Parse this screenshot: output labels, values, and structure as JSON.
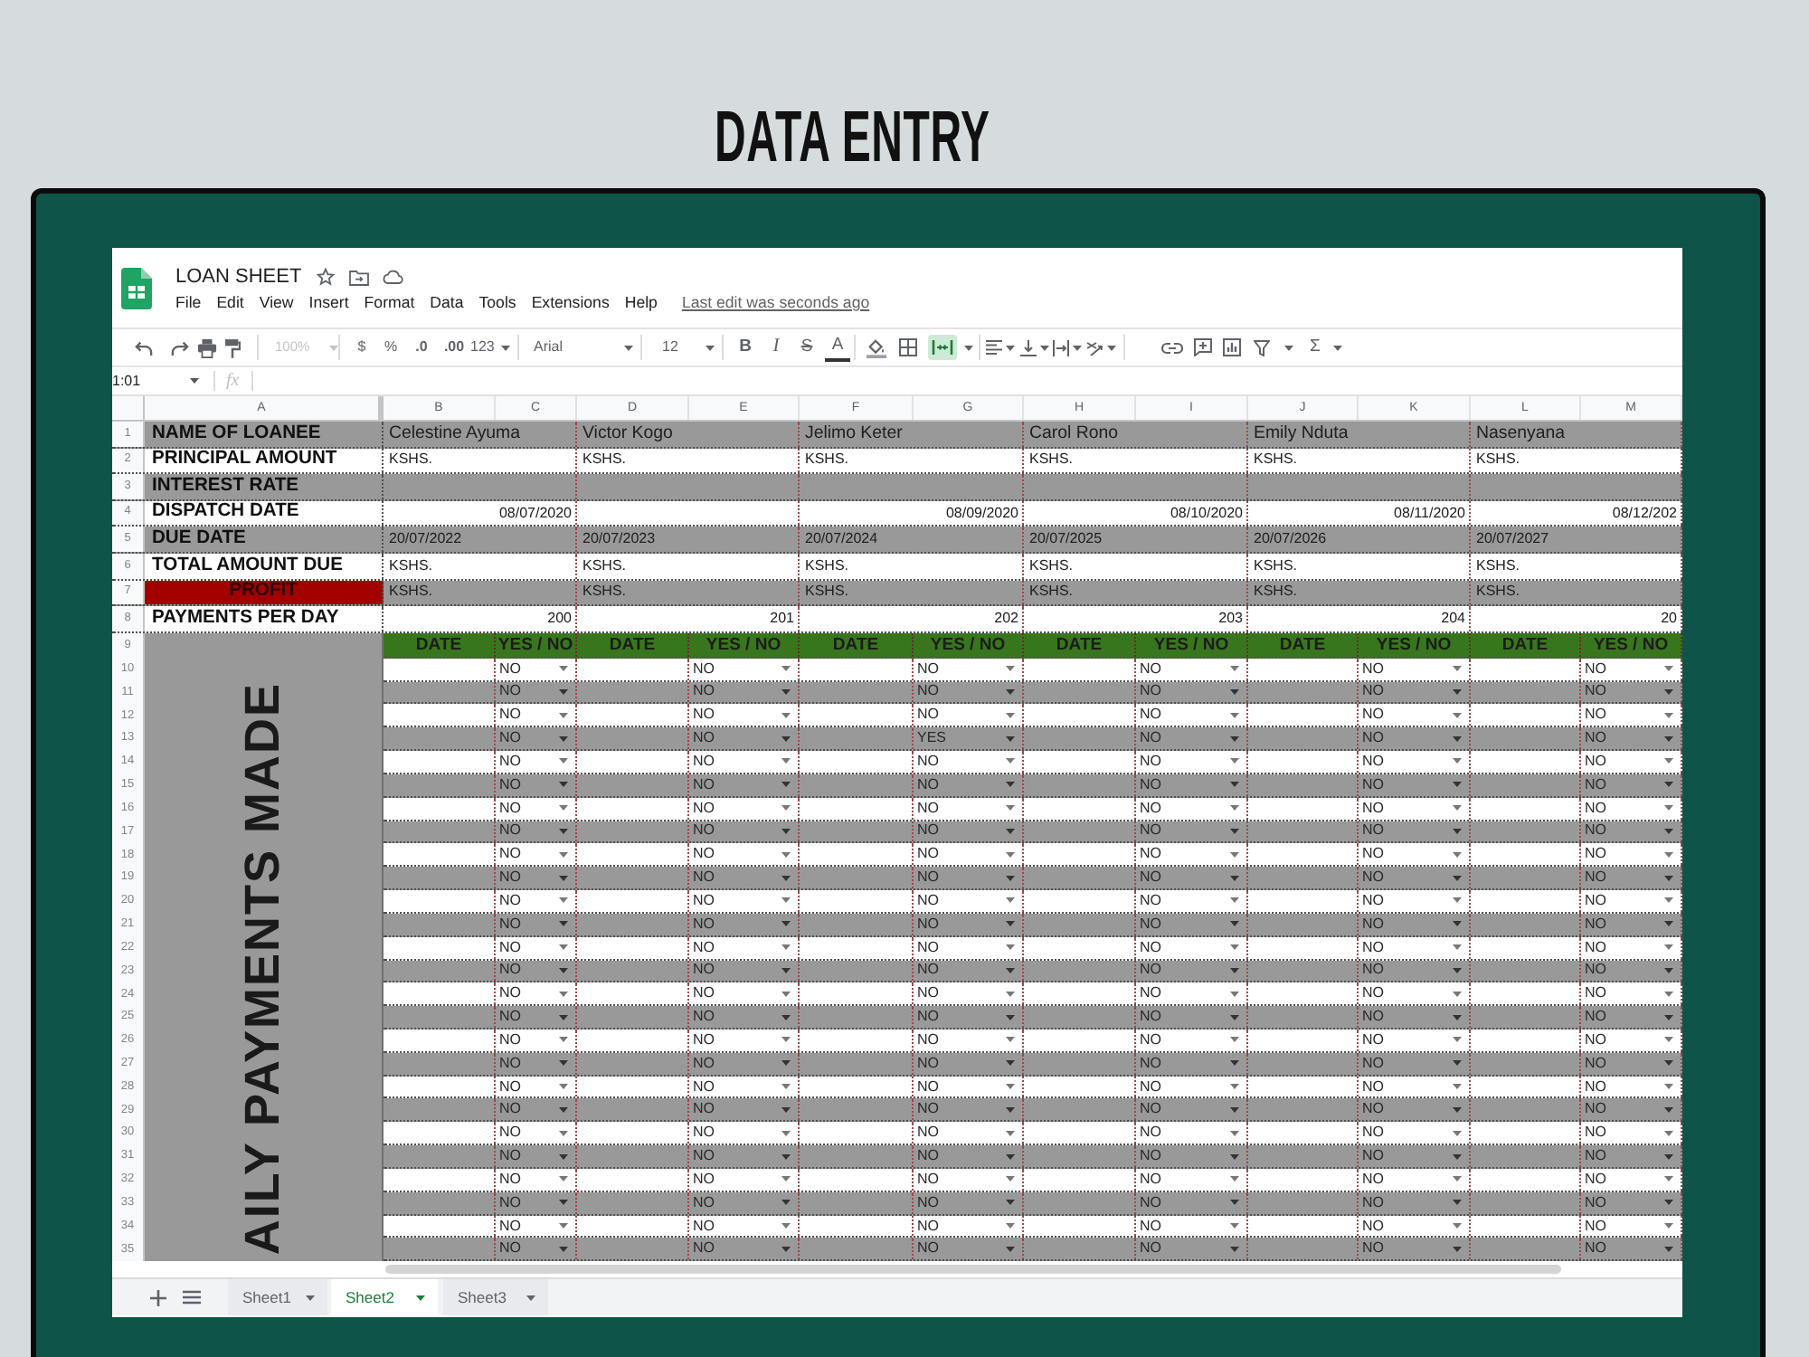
{
  "heading": "DATA ENTRY",
  "app": {
    "title": "LOAN SHEET",
    "menu": [
      "File",
      "Edit",
      "View",
      "Insert",
      "Format",
      "Data",
      "Tools",
      "Extensions",
      "Help"
    ],
    "last_edit": "Last edit was seconds ago"
  },
  "toolbar": {
    "zoom": "100%",
    "zoom_disabled": true,
    "currency": "$",
    "percent": "%",
    "decrease_decimals": ".0",
    "increase_decimals": ".00",
    "more_formats": "123",
    "font": "Arial",
    "font_size": "12",
    "bold": "B",
    "italic": "I",
    "strikethrough": "S",
    "text_color": "A",
    "merge_on": true,
    "functions": "Σ"
  },
  "formula_bar": {
    "name_box": "1:01",
    "fx": "fx"
  },
  "sheet": {
    "columns": [
      "A",
      "B",
      "C",
      "D",
      "E",
      "F",
      "G",
      "H",
      "I",
      "J",
      "K",
      "L",
      "M"
    ],
    "row_labels": [
      {
        "number": "1",
        "label": "NAME OF LOANEE",
        "alert": false
      },
      {
        "number": "2",
        "label": "PRINCIPAL AMOUNT",
        "alert": false
      },
      {
        "number": "3",
        "label": "INTEREST RATE",
        "alert": false
      },
      {
        "number": "4",
        "label": "DISPATCH DATE",
        "alert": false
      },
      {
        "number": "5",
        "label": "DUE DATE",
        "alert": false
      },
      {
        "number": "6",
        "label": "TOTAL AMOUNT DUE",
        "alert": false
      },
      {
        "number": "7",
        "label": "PROFIT",
        "alert": true
      },
      {
        "number": "8",
        "label": "PAYMENTS PER DAY",
        "alert": false
      }
    ],
    "loanees": [
      {
        "name": "Celestine Ayuma",
        "principal": "KSHS.",
        "dispatch_date": "08/07/2020",
        "due_date": "20/07/2022",
        "total_due": "KSHS.",
        "profit": "KSHS.",
        "payments_per_day": "200"
      },
      {
        "name": "Victor Kogo",
        "principal": "KSHS.",
        "due_date": "20/07/2023",
        "total_due": "KSHS.",
        "profit": "KSHS.",
        "payments_per_day": "201"
      },
      {
        "name": "Jelimo Keter",
        "principal": "KSHS.",
        "dispatch_date": "08/09/2020",
        "due_date": "20/07/2024",
        "total_due": "KSHS.",
        "profit": "KSHS.",
        "payments_per_day": "202"
      },
      {
        "name": "Carol Rono",
        "principal": "KSHS.",
        "dispatch_date": "08/10/2020",
        "due_date": "20/07/2025",
        "total_due": "KSHS.",
        "profit": "KSHS.",
        "payments_per_day": "203"
      },
      {
        "name": "Emily Nduta",
        "principal": "KSHS.",
        "dispatch_date": "08/11/2020",
        "due_date": "20/07/2026",
        "total_due": "KSHS.",
        "profit": "KSHS.",
        "payments_per_day": "204"
      },
      {
        "name": "Nasenyana",
        "principal": "KSHS.",
        "dispatch_date": "08/12/202",
        "due_date": "20/07/2027",
        "total_due": "KSHS.",
        "profit": "KSHS.",
        "payments_per_day": "20"
      }
    ],
    "payments": {
      "number": "9",
      "side_label": "AILY PAYMENTS MADE",
      "headers": [
        "DATE",
        "YES / NO",
        "DATE",
        "YES / NO",
        "DATE",
        "YES / NO",
        "DATE",
        "YES / NO",
        "DATE",
        "YES / NO",
        "DATE",
        "YES / NO"
      ],
      "rows": [
        {
          "number": "10",
          "answers": [
            "NO",
            "NO",
            "NO",
            "NO",
            "NO",
            "NO"
          ]
        },
        {
          "number": "11",
          "answers": [
            "NO",
            "NO",
            "NO",
            "NO",
            "NO",
            "NO"
          ]
        },
        {
          "number": "12",
          "answers": [
            "NO",
            "NO",
            "NO",
            "NO",
            "NO",
            "NO"
          ]
        },
        {
          "number": "13",
          "answers": [
            "NO",
            "NO",
            "YES",
            "NO",
            "NO",
            "NO"
          ]
        },
        {
          "number": "14",
          "answers": [
            "NO",
            "NO",
            "NO",
            "NO",
            "NO",
            "NO"
          ]
        },
        {
          "number": "15",
          "answers": [
            "NO",
            "NO",
            "NO",
            "NO",
            "NO",
            "NO"
          ]
        },
        {
          "number": "16",
          "answers": [
            "NO",
            "NO",
            "NO",
            "NO",
            "NO",
            "NO"
          ]
        },
        {
          "number": "17",
          "answers": [
            "NO",
            "NO",
            "NO",
            "NO",
            "NO",
            "NO"
          ]
        },
        {
          "number": "18",
          "answers": [
            "NO",
            "NO",
            "NO",
            "NO",
            "NO",
            "NO"
          ]
        },
        {
          "number": "19",
          "answers": [
            "NO",
            "NO",
            "NO",
            "NO",
            "NO",
            "NO"
          ]
        },
        {
          "number": "20",
          "answers": [
            "NO",
            "NO",
            "NO",
            "NO",
            "NO",
            "NO"
          ]
        },
        {
          "number": "21",
          "answers": [
            "NO",
            "NO",
            "NO",
            "NO",
            "NO",
            "NO"
          ]
        },
        {
          "number": "22",
          "answers": [
            "NO",
            "NO",
            "NO",
            "NO",
            "NO",
            "NO"
          ]
        },
        {
          "number": "23",
          "answers": [
            "NO",
            "NO",
            "NO",
            "NO",
            "NO",
            "NO"
          ]
        },
        {
          "number": "24",
          "answers": [
            "NO",
            "NO",
            "NO",
            "NO",
            "NO",
            "NO"
          ]
        },
        {
          "number": "25",
          "answers": [
            "NO",
            "NO",
            "NO",
            "NO",
            "NO",
            "NO"
          ]
        },
        {
          "number": "26",
          "answers": [
            "NO",
            "NO",
            "NO",
            "NO",
            "NO",
            "NO"
          ]
        },
        {
          "number": "27",
          "answers": [
            "NO",
            "NO",
            "NO",
            "NO",
            "NO",
            "NO"
          ]
        },
        {
          "number": "28",
          "answers": [
            "NO",
            "NO",
            "NO",
            "NO",
            "NO",
            "NO"
          ]
        },
        {
          "number": "29",
          "answers": [
            "NO",
            "NO",
            "NO",
            "NO",
            "NO",
            "NO"
          ]
        },
        {
          "number": "30",
          "answers": [
            "NO",
            "NO",
            "NO",
            "NO",
            "NO",
            "NO"
          ]
        },
        {
          "number": "31",
          "answers": [
            "NO",
            "NO",
            "NO",
            "NO",
            "NO",
            "NO"
          ]
        },
        {
          "number": "32",
          "answers": [
            "NO",
            "NO",
            "NO",
            "NO",
            "NO",
            "NO"
          ]
        },
        {
          "number": "33",
          "answers": [
            "NO",
            "NO",
            "NO",
            "NO",
            "NO",
            "NO"
          ]
        },
        {
          "number": "34",
          "answers": [
            "NO",
            "NO",
            "NO",
            "NO",
            "NO",
            "NO"
          ]
        },
        {
          "number": "35",
          "answers": [
            "NO",
            "NO",
            "NO",
            "NO",
            "NO",
            "NO"
          ]
        }
      ]
    }
  },
  "sheet_tabs": [
    {
      "label": "Sheet1",
      "selected": false
    },
    {
      "label": "Sheet2",
      "selected": true
    },
    {
      "label": "Sheet3",
      "selected": false
    }
  ]
}
